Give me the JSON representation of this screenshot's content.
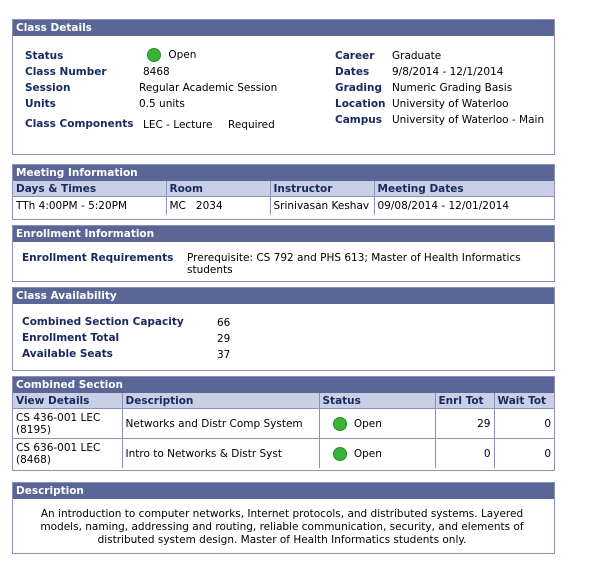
{
  "class_details": {
    "header": "Class Details",
    "status_label": "Status",
    "status_value": "Open",
    "class_number_label": "Class Number",
    "class_number_value": "8468",
    "session_label": "Session",
    "session_value": "Regular Academic Session",
    "units_label": "Units",
    "units_value": "0.5 units",
    "components_label": "Class Components",
    "components_value": "LEC - Lecture",
    "components_req": "Required",
    "career_label": "Career",
    "career_value": "Graduate",
    "dates_label": "Dates",
    "dates_value": "9/8/2014 - 12/1/2014",
    "grading_label": "Grading",
    "grading_value": "Numeric Grading Basis",
    "location_label": "Location",
    "location_value": "University of Waterloo",
    "campus_label": "Campus",
    "campus_value": "University of Waterloo - Main",
    "status_color": "#39b337"
  },
  "meeting_info": {
    "header": "Meeting Information",
    "columns": [
      "Days & Times",
      "Room",
      "Instructor",
      "Meeting Dates"
    ],
    "rows": [
      [
        "TTh 4:00PM - 5:20PM",
        "MC   2034",
        "Srinivasan Keshav",
        "09/08/2014 - 12/01/2014"
      ]
    ]
  },
  "enrollment_info": {
    "header": "Enrollment Information",
    "req_label": "Enrollment Requirements",
    "req_value": "Prerequisite: CS 792 and PHS 613; Master of Health Informatics students"
  },
  "availability": {
    "header": "Class Availability",
    "capacity_label": "Combined Section Capacity",
    "capacity_value": "66",
    "total_label": "Enrollment Total",
    "total_value": "29",
    "seats_label": "Available Seats",
    "seats_value": "37"
  },
  "combined": {
    "header": "Combined Section",
    "columns": [
      "View Details",
      "Description",
      "Status",
      "Enrl Tot",
      "Wait Tot"
    ],
    "rows": [
      {
        "details": "CS 436-001 LEC (8195)",
        "description": "Networks and Distr Comp System",
        "status": "Open",
        "enrl": "29",
        "wait": "0"
      },
      {
        "details": "CS 636-001 LEC (8468)",
        "description": "Intro to Networks & Distr Syst",
        "status": "Open",
        "enrl": "0",
        "wait": "0"
      }
    ]
  },
  "description": {
    "header": "Description",
    "text": "An introduction to computer networks, Internet protocols, and distributed systems.  Layered models, naming, addressing and routing, reliable communication, security, and elements of distributed system design. Master of Health Informatics students only."
  },
  "colors": {
    "header_bg": "#5a6696",
    "column_header_bg": "#c9cfe4",
    "border": "#8c8fb7",
    "label": "#1a2a60"
  }
}
